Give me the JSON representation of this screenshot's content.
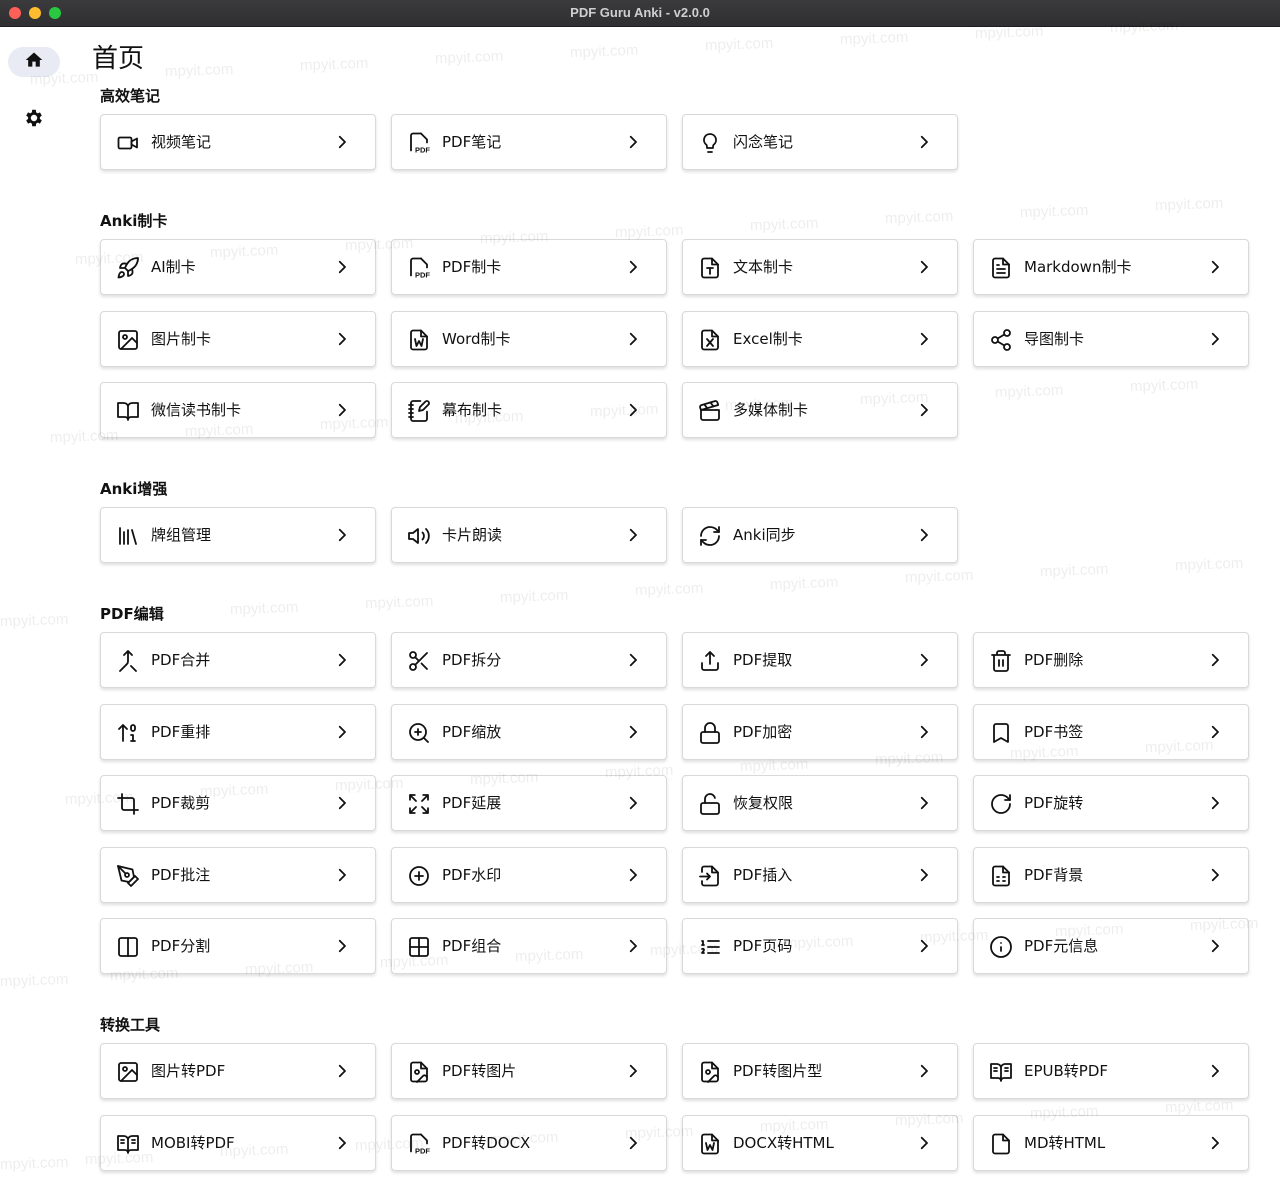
{
  "window": {
    "title": "PDF Guru Anki - v2.0.0"
  },
  "sidebar": {
    "items": [
      {
        "name": "home",
        "icon": "home-icon",
        "active": true
      },
      {
        "name": "settings",
        "icon": "gear-icon",
        "active": false
      }
    ]
  },
  "page": {
    "title": "首页"
  },
  "sections": [
    {
      "title": "高效笔记",
      "items": [
        {
          "label": "视频笔记",
          "icon": "video"
        },
        {
          "label": "PDF笔记",
          "icon": "pdf"
        },
        {
          "label": "闪念笔记",
          "icon": "bulb"
        }
      ]
    },
    {
      "title": "Anki制卡",
      "items": [
        {
          "label": "AI制卡",
          "icon": "rocket"
        },
        {
          "label": "PDF制卡",
          "icon": "pdf"
        },
        {
          "label": "文本制卡",
          "icon": "text-file"
        },
        {
          "label": "Markdown制卡",
          "icon": "doc-lines"
        },
        {
          "label": "图片制卡",
          "icon": "image"
        },
        {
          "label": "Word制卡",
          "icon": "word"
        },
        {
          "label": "Excel制卡",
          "icon": "excel"
        },
        {
          "label": "导图制卡",
          "icon": "share"
        },
        {
          "label": "微信读书制卡",
          "icon": "book-open"
        },
        {
          "label": "幕布制卡",
          "icon": "notebook-pen"
        },
        {
          "label": "多媒体制卡",
          "icon": "clapper"
        }
      ]
    },
    {
      "title": "Anki增强",
      "items": [
        {
          "label": "牌组管理",
          "icon": "library"
        },
        {
          "label": "卡片朗读",
          "icon": "speaker"
        },
        {
          "label": "Anki同步",
          "icon": "sync"
        }
      ]
    },
    {
      "title": "PDF编辑",
      "items": [
        {
          "label": "PDF合并",
          "icon": "merge"
        },
        {
          "label": "PDF拆分",
          "icon": "scissors"
        },
        {
          "label": "PDF提取",
          "icon": "upload"
        },
        {
          "label": "PDF删除",
          "icon": "trash"
        },
        {
          "label": "PDF重排",
          "icon": "sort"
        },
        {
          "label": "PDF缩放",
          "icon": "zoom"
        },
        {
          "label": "PDF加密",
          "icon": "lock"
        },
        {
          "label": "PDF书签",
          "icon": "bookmark"
        },
        {
          "label": "PDF裁剪",
          "icon": "crop"
        },
        {
          "label": "PDF延展",
          "icon": "expand"
        },
        {
          "label": "恢复权限",
          "icon": "unlock"
        },
        {
          "label": "PDF旋转",
          "icon": "rotate"
        },
        {
          "label": "PDF批注",
          "icon": "pen"
        },
        {
          "label": "PDF水印",
          "icon": "plus-circle"
        },
        {
          "label": "PDF插入",
          "icon": "file-import"
        },
        {
          "label": "PDF背景",
          "icon": "file-grid"
        },
        {
          "label": "PDF分割",
          "icon": "split"
        },
        {
          "label": "PDF组合",
          "icon": "grid"
        },
        {
          "label": "PDF页码",
          "icon": "list-numbers"
        },
        {
          "label": "PDF元信息",
          "icon": "info"
        }
      ]
    },
    {
      "title": "转换工具",
      "items": [
        {
          "label": "图片转PDF",
          "icon": "image"
        },
        {
          "label": "PDF转图片",
          "icon": "file-image"
        },
        {
          "label": "PDF转图片型",
          "icon": "file-image"
        },
        {
          "label": "EPUB转PDF",
          "icon": "book-open-2"
        },
        {
          "label": "MOBI转PDF",
          "icon": "book-open-2"
        },
        {
          "label": "PDF转DOCX",
          "icon": "pdf"
        },
        {
          "label": "DOCX转HTML",
          "icon": "word"
        },
        {
          "label": "MD转HTML",
          "icon": "file"
        }
      ]
    }
  ],
  "watermark": "mpyit.com"
}
